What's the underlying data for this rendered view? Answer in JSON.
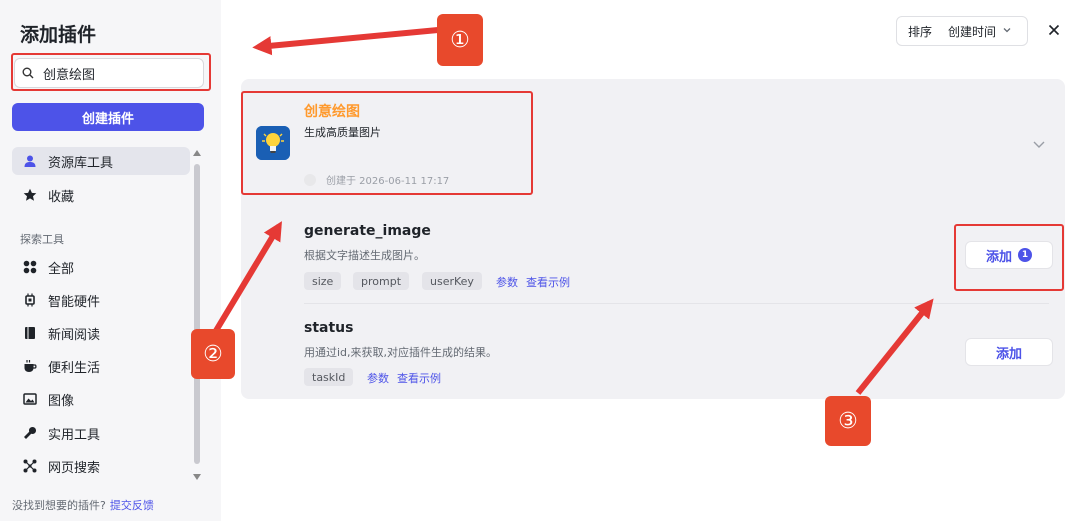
{
  "dialog": {
    "title": "添加插件",
    "close_icon": "close-icon"
  },
  "search": {
    "value": "创意绘图",
    "placeholder": "",
    "icon": "search-icon"
  },
  "sidebar": {
    "create_label": "创建插件",
    "items": [
      {
        "label": "资源库工具",
        "icon": "user-icon",
        "active": true
      },
      {
        "label": "收藏",
        "icon": "star-icon"
      }
    ],
    "section_label": "探索工具",
    "explore": [
      {
        "label": "全部",
        "icon": "grid-icon"
      },
      {
        "label": "智能硬件",
        "icon": "chip-icon"
      },
      {
        "label": "新闻阅读",
        "icon": "book-icon"
      },
      {
        "label": "便利生活",
        "icon": "cup-icon"
      },
      {
        "label": "图像",
        "icon": "image-icon"
      },
      {
        "label": "实用工具",
        "icon": "wrench-icon"
      },
      {
        "label": "网页搜索",
        "icon": "network-icon"
      }
    ],
    "footer_text": "没找到想要的插件?",
    "footer_link": "提交反馈"
  },
  "sort": {
    "label": "排序",
    "value": "创建时间"
  },
  "plugin": {
    "name": "创意绘图",
    "description": "生成高质量图片",
    "created": "创建于 2026-06-11 17:17",
    "icon": "lightbulb-icon"
  },
  "tools": [
    {
      "name": "generate_image",
      "description": "根据文字描述生成图片。",
      "params": [
        "size",
        "prompt",
        "userKey"
      ],
      "params_link": "参数",
      "example_link": "查看示例",
      "add_label": "添加",
      "badge": "1"
    },
    {
      "name": "status",
      "description": "用通过id,来获取,对应插件生成的结果。",
      "params": [
        "taskId"
      ],
      "params_link": "参数",
      "example_link": "查看示例",
      "add_label": "添加"
    }
  ],
  "annotations": {
    "n1": "①",
    "n2": "②",
    "n3": "③"
  },
  "colors": {
    "accent": "#4d53e8",
    "plugin_name": "#ff9a2e",
    "annotation_red": "#e53935"
  }
}
